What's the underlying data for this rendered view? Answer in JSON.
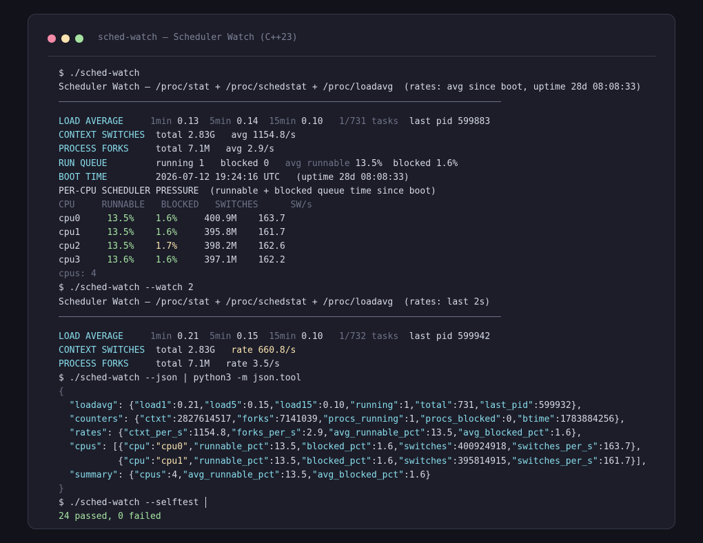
{
  "colors": {
    "dot_red": "#f38ba8",
    "dot_yellow": "#f9e2af",
    "dot_green": "#a6e3a1"
  },
  "window": {
    "title": "sched-watch — Scheduler Watch (C++23)"
  },
  "run1": {
    "prompt": "$ ./sched-watch",
    "header": "Scheduler Watch — /proc/stat + /proc/schedstat + /proc/loadavg  (rates: avg since boot, uptime 28d 08:08:33)",
    "rule": "────────────────────────────────────────────────────────────────────────────",
    "load": {
      "label": "LOAD AVERAGE",
      "l1k": "1min",
      "l1v": "0.13",
      "l5k": "5min",
      "l5v": "0.14",
      "l15k": "15min",
      "l15v": "0.10",
      "tasks": "1/731 tasks",
      "pid": "last pid 599883"
    },
    "ctx": {
      "label": "CONTEXT SWITCHES",
      "total": "total 2.83G",
      "avg": "avg 1154.8/s"
    },
    "forks": {
      "label": "PROCESS FORKS",
      "total": "total 7.1M",
      "avg": "avg 2.9/s"
    },
    "runq": {
      "label": "RUN QUEUE",
      "a": "running 1   blocked 0",
      "b": "avg runnable",
      "c": "13.5%  blocked 1.6%"
    },
    "boot": {
      "label": "BOOT TIME",
      "value": "2026-07-12 19:24:16 UTC   (uptime 28d 08:08:33)"
    },
    "percpu_title": "PER-CPU SCHEDULER PRESSURE  (runnable + blocked queue time since boot)",
    "cpu_header": [
      "CPU",
      "RUNNABLE",
      "BLOCKED",
      "SWITCHES",
      "SW/s"
    ],
    "cpus": [
      {
        "name": "cpu0",
        "runnable": "13.5%",
        "blocked": "1.6%",
        "switches": "400.9M",
        "sws": "163.7"
      },
      {
        "name": "cpu1",
        "runnable": "13.5%",
        "blocked": "1.6%",
        "switches": "395.8M",
        "sws": "161.7"
      },
      {
        "name": "cpu2",
        "runnable": "13.5%",
        "blocked": "1.7%",
        "switches": "398.2M",
        "sws": "162.6"
      },
      {
        "name": "cpu3",
        "runnable": "13.6%",
        "blocked": "1.6%",
        "switches": "397.1M",
        "sws": "162.2"
      }
    ],
    "cpus_count": "cpus: 4"
  },
  "run2": {
    "prompt": "$ ./sched-watch --watch 2",
    "header": "Scheduler Watch — /proc/stat + /proc/schedstat + /proc/loadavg  (rates: last 2s)",
    "rule": "────────────────────────────────────────────────────────────────────────────",
    "load": {
      "label": "LOAD AVERAGE",
      "l1k": "1min",
      "l1v": "0.21",
      "l5k": "5min",
      "l5v": "0.15",
      "l15k": "15min",
      "l15v": "0.10",
      "tasks": "1/732 tasks",
      "pid": "last pid 599942"
    },
    "ctx": {
      "label": "CONTEXT SWITCHES",
      "total": "total 2.83G",
      "rate": "rate 660.8/s"
    },
    "forks": {
      "label": "PROCESS FORKS",
      "total": "total 7.1M",
      "rate": "rate 3.5/s"
    }
  },
  "run3": {
    "prompt": "$ ./sched-watch --json | python3 -m json.tool",
    "open": "{",
    "close": "}",
    "lines": [
      [
        [
          "  ",
          "w"
        ],
        [
          "\"loadavg\"",
          "c"
        ],
        [
          ": {",
          "w"
        ],
        [
          "\"load1\"",
          "c"
        ],
        [
          ":0.21,",
          "w"
        ],
        [
          "\"load5\"",
          "c"
        ],
        [
          ":0.15,",
          "w"
        ],
        [
          "\"load15\"",
          "c"
        ],
        [
          ":0.10,",
          "w"
        ],
        [
          "\"running\"",
          "c"
        ],
        [
          ":1,",
          "w"
        ],
        [
          "\"total\"",
          "c"
        ],
        [
          ":731,",
          "w"
        ],
        [
          "\"last_pid\"",
          "c"
        ],
        [
          ":599932},",
          "w"
        ]
      ],
      [
        [
          "  ",
          "w"
        ],
        [
          "\"counters\"",
          "c"
        ],
        [
          ": {",
          "w"
        ],
        [
          "\"ctxt\"",
          "c"
        ],
        [
          ":2827614517,",
          "w"
        ],
        [
          "\"forks\"",
          "c"
        ],
        [
          ":7141039,",
          "w"
        ],
        [
          "\"procs_running\"",
          "c"
        ],
        [
          ":1,",
          "w"
        ],
        [
          "\"procs_blocked\"",
          "c"
        ],
        [
          ":0,",
          "w"
        ],
        [
          "\"btime\"",
          "c"
        ],
        [
          ":1783884256},",
          "w"
        ]
      ],
      [
        [
          "  ",
          "w"
        ],
        [
          "\"rates\"",
          "c"
        ],
        [
          ": {",
          "w"
        ],
        [
          "\"ctxt_per_s\"",
          "c"
        ],
        [
          ":1154.8,",
          "w"
        ],
        [
          "\"forks_per_s\"",
          "c"
        ],
        [
          ":2.9,",
          "w"
        ],
        [
          "\"avg_runnable_pct\"",
          "c"
        ],
        [
          ":13.5,",
          "w"
        ],
        [
          "\"avg_blocked_pct\"",
          "c"
        ],
        [
          ":1.6},",
          "w"
        ]
      ],
      [
        [
          "  ",
          "w"
        ],
        [
          "\"cpus\"",
          "c"
        ],
        [
          ": [{",
          "w"
        ],
        [
          "\"cpu\"",
          "c"
        ],
        [
          ":",
          "w"
        ],
        [
          "\"cpu0\"",
          "y"
        ],
        [
          ",",
          "w"
        ],
        [
          "\"runnable_pct\"",
          "c"
        ],
        [
          ":13.5,",
          "w"
        ],
        [
          "\"blocked_pct\"",
          "c"
        ],
        [
          ":1.6,",
          "w"
        ],
        [
          "\"switches\"",
          "c"
        ],
        [
          ":400924918,",
          "w"
        ],
        [
          "\"switches_per_s\"",
          "c"
        ],
        [
          ":163.7},",
          "w"
        ]
      ],
      [
        [
          "           {",
          "w"
        ],
        [
          "\"cpu\"",
          "c"
        ],
        [
          ":",
          "w"
        ],
        [
          "\"cpu1\"",
          "y"
        ],
        [
          ",",
          "w"
        ],
        [
          "\"runnable_pct\"",
          "c"
        ],
        [
          ":13.5,",
          "w"
        ],
        [
          "\"blocked_pct\"",
          "c"
        ],
        [
          ":1.6,",
          "w"
        ],
        [
          "\"switches\"",
          "c"
        ],
        [
          ":395814915,",
          "w"
        ],
        [
          "\"switches_per_s\"",
          "c"
        ],
        [
          ":161.7}],",
          "w"
        ]
      ],
      [
        [
          "  ",
          "w"
        ],
        [
          "\"summary\"",
          "c"
        ],
        [
          ": {",
          "w"
        ],
        [
          "\"cpus\"",
          "c"
        ],
        [
          ":4,",
          "w"
        ],
        [
          "\"avg_runnable_pct\"",
          "c"
        ],
        [
          ":13.5,",
          "w"
        ],
        [
          "\"avg_blocked_pct\"",
          "c"
        ],
        [
          ":1.6}",
          "w"
        ]
      ]
    ]
  },
  "run4": {
    "prompt": "$ ./sched-watch --selftest",
    "result": "24 passed, 0 failed"
  }
}
